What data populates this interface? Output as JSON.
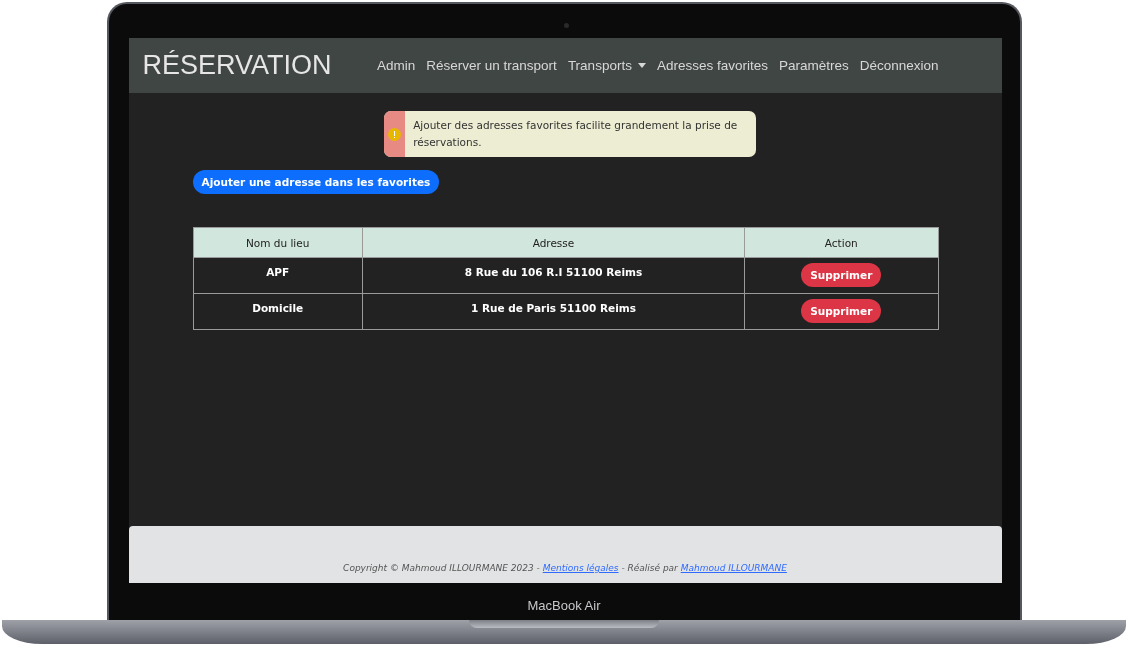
{
  "device": {
    "label": "MacBook Air"
  },
  "navbar": {
    "brand": "RÉSERVATION",
    "items": [
      {
        "label": "Admin",
        "has_dropdown": false
      },
      {
        "label": "Réserver un transport",
        "has_dropdown": false
      },
      {
        "label": "Transports",
        "has_dropdown": true
      },
      {
        "label": "Adresses favorites",
        "has_dropdown": false
      },
      {
        "label": "Paramètres",
        "has_dropdown": false
      },
      {
        "label": "Déconnexion",
        "has_dropdown": false
      }
    ]
  },
  "alert": {
    "text": "Ajouter des adresses favorites facilite grandement la prise de réservations."
  },
  "add_button": "Ajouter une adresse dans les favorites",
  "table": {
    "columns": [
      "Nom du lieu",
      "Adresse",
      "Action"
    ],
    "rows": [
      {
        "name": "APF",
        "address": "8 Rue du 106 R.I 51100 Reims",
        "action": "Supprimer"
      },
      {
        "name": "Domicile",
        "address": "1 Rue de Paris 51100 Reims",
        "action": "Supprimer"
      }
    ]
  },
  "footer": {
    "copyright": "Copyright © Mahmoud ILLOURMANE 2023 - ",
    "legal_link": "Mentions légales",
    "credit": " - Réalisé par ",
    "author_link": "Mahmoud ILLOURMANE"
  }
}
